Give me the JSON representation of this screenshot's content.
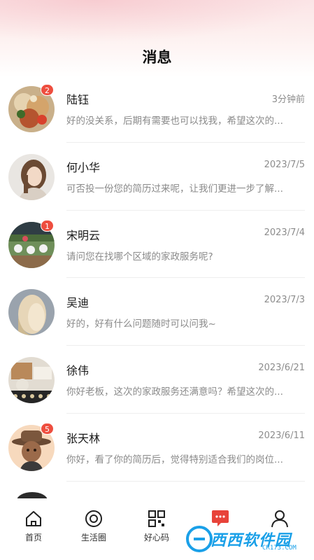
{
  "header": {
    "title": "消息"
  },
  "messages": [
    {
      "name": "陆钰",
      "time": "3分钟前",
      "preview": "好的没关系，后期有需要也可以找我，希望这次的...",
      "badge": "2",
      "avatar_icon": "food-photo-avatar"
    },
    {
      "name": "何小华",
      "time": "2023/7/5",
      "preview": "可否投一份您的简历过来呢，让我们更进一步了解...",
      "badge": "",
      "avatar_icon": "woman-portrait-avatar"
    },
    {
      "name": "宋明云",
      "time": "2023/7/4",
      "preview": "请问您在找哪个区域的家政服务呢?",
      "badge": "1",
      "avatar_icon": "outdoor-scene-avatar"
    },
    {
      "name": "吴迪",
      "time": "2023/7/3",
      "preview": "好的，好有什么问题随时可以问我~",
      "badge": "",
      "avatar_icon": "blonde-hair-avatar"
    },
    {
      "name": "徐伟",
      "time": "2023/6/21",
      "preview": "你好老板，这次的家政服务还满意吗？希望这次的...",
      "badge": "",
      "avatar_icon": "still-life-avatar"
    },
    {
      "name": "张天林",
      "time": "2023/6/11",
      "preview": "你好，看了你的简历后，觉得特别适合我们的岗位...",
      "badge": "5",
      "avatar_icon": "cartoon-cowboy-avatar"
    }
  ],
  "tabbar": {
    "items": [
      {
        "label": "首页",
        "icon": "home-icon"
      },
      {
        "label": "生活圈",
        "icon": "circle-target-icon"
      },
      {
        "label": "好心码",
        "icon": "qr-code-icon"
      },
      {
        "label": "",
        "icon": "message-icon",
        "active": true
      },
      {
        "label": "",
        "icon": "profile-icon"
      }
    ]
  },
  "watermark": {
    "text": "西西软件园",
    "sub": "CR173.COM"
  },
  "colors": {
    "badge": "#ee4e3f",
    "active_tab": "#e8433a",
    "watermark": "#1aa0e8"
  }
}
